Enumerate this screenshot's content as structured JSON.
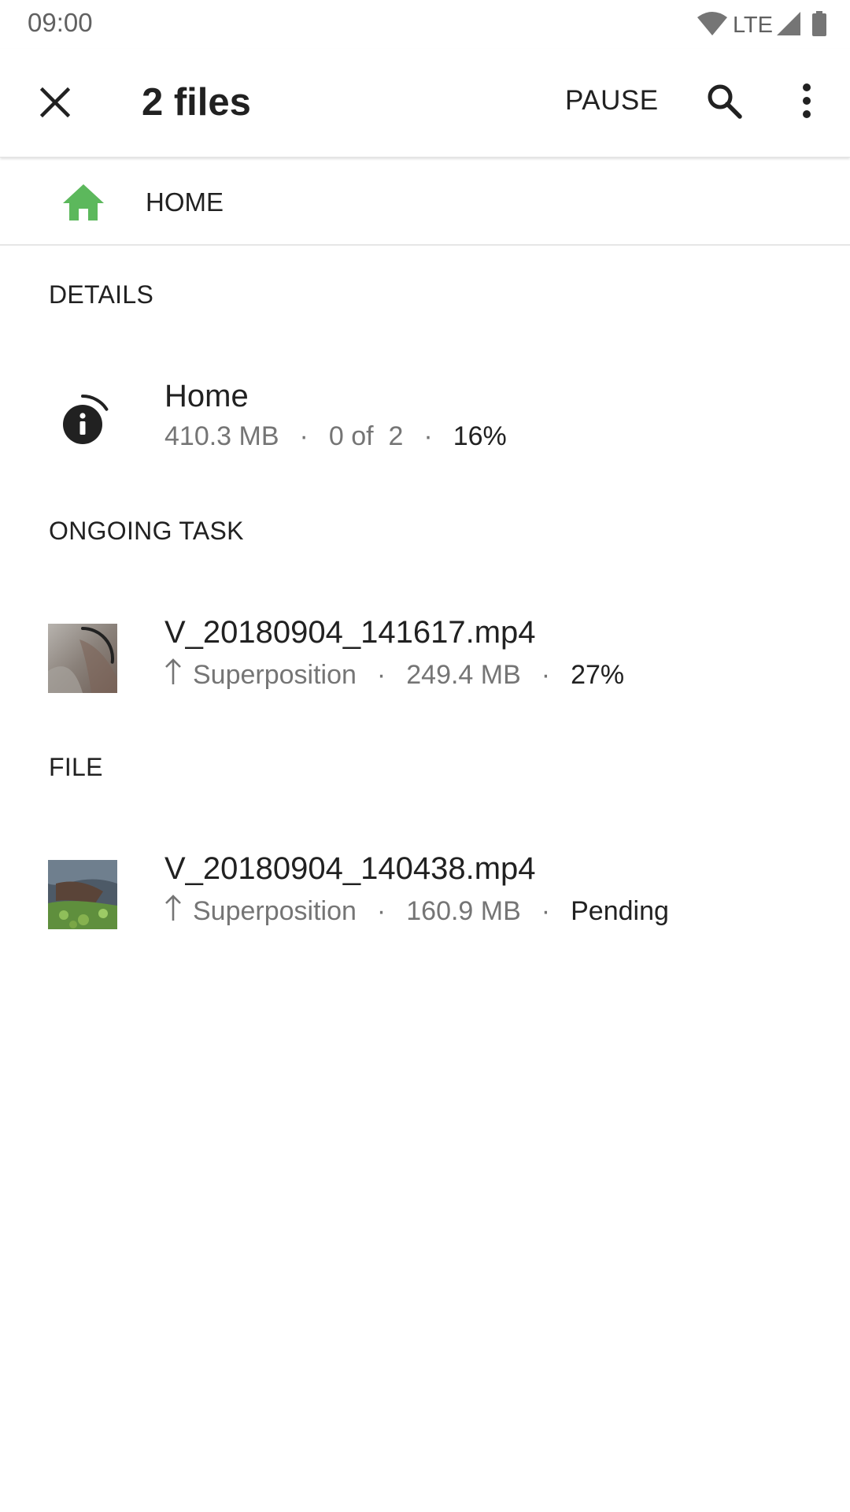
{
  "status_bar": {
    "time": "09:00",
    "network": "LTE",
    "icons": [
      "wifi-icon",
      "cell-signal-icon",
      "battery-icon"
    ]
  },
  "app_bar": {
    "title": "2 files",
    "pause_label": "PAUSE",
    "icons": [
      "close-icon",
      "search-icon",
      "more-vert-icon"
    ]
  },
  "breadcrumb": {
    "icon": "home-icon",
    "icon_color": "#5cb85c",
    "label": "HOME"
  },
  "sections": {
    "details": {
      "header": "DETAILS",
      "item": {
        "icon": "info-progress-icon",
        "title": "Home",
        "size": "410.3 MB",
        "count": "0 of  2",
        "progress": "16%"
      }
    },
    "ongoing": {
      "header": "ONGOING TASK",
      "item": {
        "thumb": "video-thumbnail-icon",
        "title": "V_20180904_141617.mp4",
        "direction_icon": "upload-arrow-icon",
        "destination": "Superposition",
        "size": "249.4 MB",
        "status": "27%",
        "progress_fraction": 0.27
      }
    },
    "file": {
      "header": "FILE",
      "item": {
        "thumb": "video-thumbnail-icon",
        "title": "V_20180904_140438.mp4",
        "direction_icon": "upload-arrow-icon",
        "destination": "Superposition",
        "size": "160.9 MB",
        "status": "Pending"
      }
    }
  }
}
